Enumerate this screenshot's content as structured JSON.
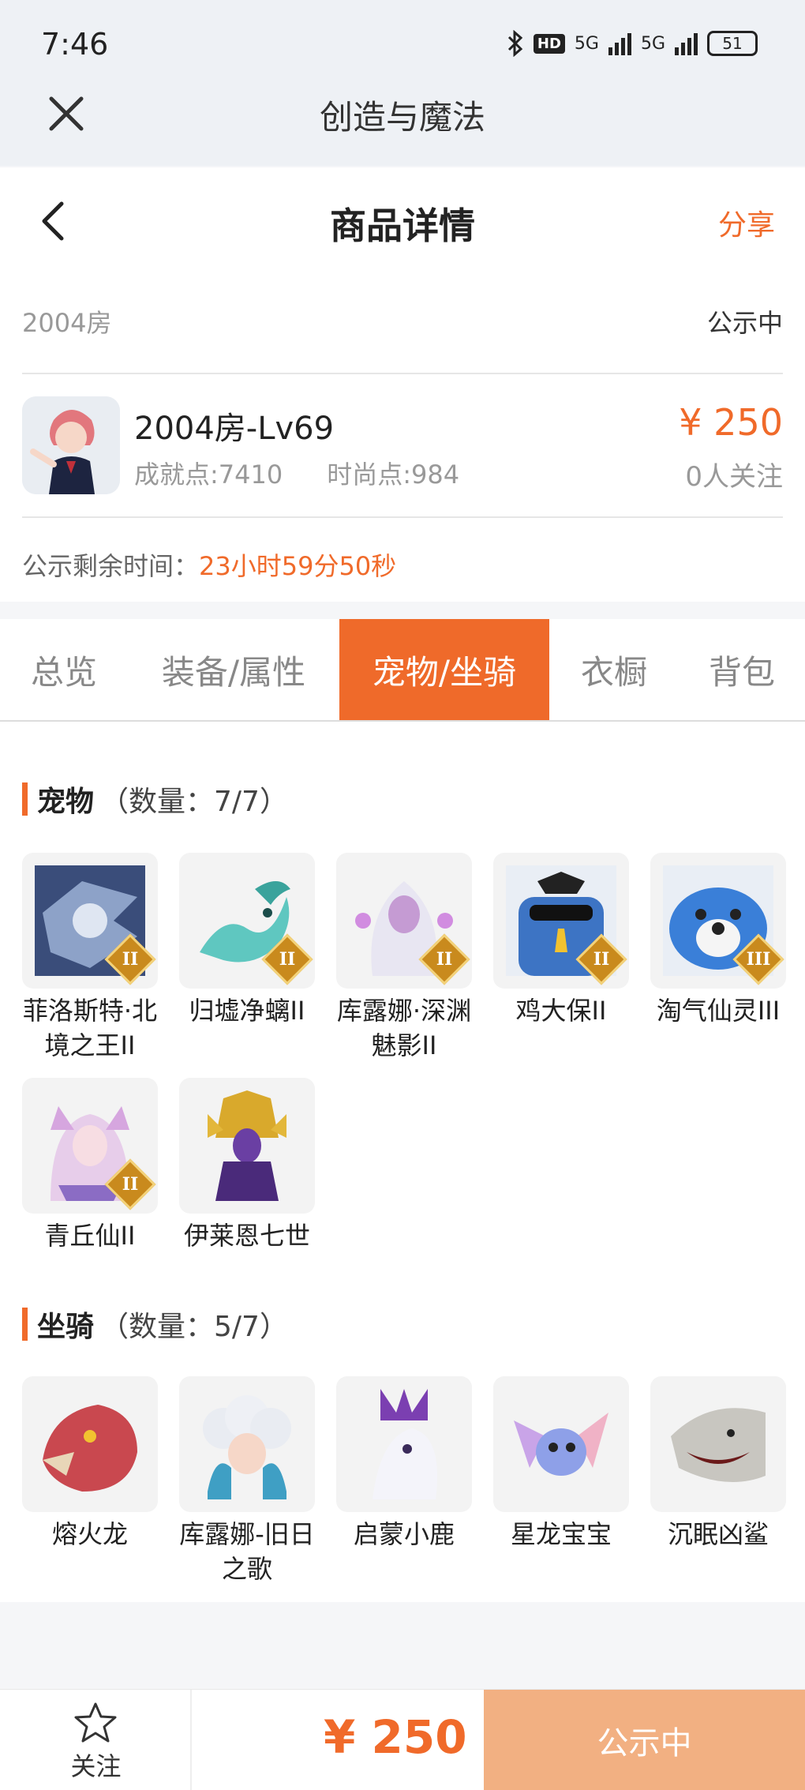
{
  "status": {
    "time": "7:46",
    "hd": "HD",
    "net1": "5G",
    "net2": "5G",
    "battery": "51"
  },
  "app_bar": {
    "title": "创造与魔法"
  },
  "header": {
    "title": "商品详情",
    "share": "分享"
  },
  "listing": {
    "room": "2004房",
    "status": "公示中",
    "title": "2004房-Lv69",
    "achievement": "成就点:7410",
    "fashion": "时尚点:984",
    "price": "¥ 250",
    "watchers": "0人关注",
    "remaining_label": "公示剩余时间：",
    "remaining_value": "23小时59分50秒"
  },
  "tabs": [
    "总览",
    "装备/属性",
    "宠物/坐骑",
    "衣橱",
    "背包"
  ],
  "active_tab": 2,
  "pets": {
    "name": "宠物",
    "count": "（数量：7/7）",
    "items": [
      {
        "label": "菲洛斯特·北境之王II",
        "tier": "II",
        "icon": "dragon-king-icon"
      },
      {
        "label": "归墟净螭II",
        "tier": "II",
        "icon": "jade-dragon-icon"
      },
      {
        "label": "库露娜·深渊魅影II",
        "tier": "II",
        "icon": "abyss-maiden-icon"
      },
      {
        "label": "鸡大保II",
        "tier": "II",
        "icon": "blue-bird-icon"
      },
      {
        "label": "淘气仙灵III",
        "tier": "III",
        "icon": "blue-dog-icon"
      },
      {
        "label": "青丘仙II",
        "tier": "II",
        "icon": "fox-fairy-icon"
      },
      {
        "label": "伊莱恩七世",
        "tier": "",
        "icon": "pharaoh-queen-icon"
      }
    ]
  },
  "mounts": {
    "name": "坐骑",
    "count": "（数量：5/7）",
    "items": [
      {
        "label": "熔火龙",
        "icon": "red-dragon-icon"
      },
      {
        "label": "库露娜-旧日之歌",
        "icon": "cloud-girl-icon"
      },
      {
        "label": "启蒙小鹿",
        "icon": "white-deer-icon"
      },
      {
        "label": "星龙宝宝",
        "icon": "star-dragon-icon"
      },
      {
        "label": "沉眠凶鲨",
        "icon": "shark-icon"
      }
    ]
  },
  "bottom": {
    "follow": "关注",
    "price": "¥ 250",
    "cta": "公示中"
  },
  "colors": {
    "accent": "#f06a2a",
    "cta_bg": "#f2b082"
  }
}
